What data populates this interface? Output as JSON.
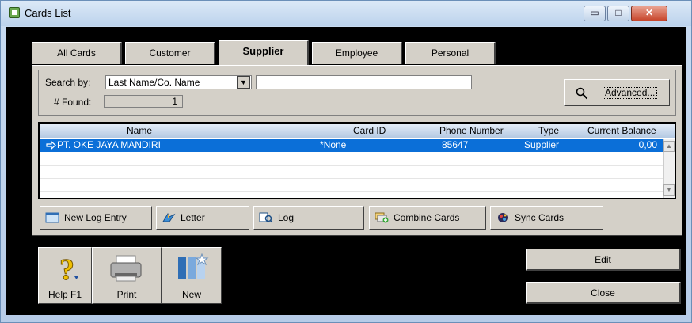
{
  "window": {
    "title": "Cards List",
    "controls": {
      "minimize": "▭",
      "maximize": "□",
      "close": "✕"
    }
  },
  "tabs": [
    {
      "label": "All Cards",
      "active": false
    },
    {
      "label": "Customer",
      "active": false
    },
    {
      "label": "Supplier",
      "active": true
    },
    {
      "label": "Employee",
      "active": false
    },
    {
      "label": "Personal",
      "active": false
    }
  ],
  "search": {
    "by_label": "Search by:",
    "by_value": "Last Name/Co. Name",
    "query": "",
    "found_label": "# Found:",
    "found_value": "1",
    "advanced_label": "Advanced..."
  },
  "table": {
    "columns": [
      "Name",
      "Card ID",
      "Phone Number",
      "Type",
      "Current Balance"
    ],
    "rows": [
      {
        "name": "PT. OKE JAYA MANDIRI",
        "card_id": "*None",
        "phone": "85647",
        "type": "Supplier",
        "balance": "0,00",
        "selected": true
      }
    ]
  },
  "actions": {
    "new_log_entry": "New Log Entry",
    "letter": "Letter",
    "log": "Log",
    "combine_cards": "Combine Cards",
    "sync_cards": "Sync Cards"
  },
  "bottom": {
    "help": "Help F1",
    "print": "Print",
    "new": "New",
    "edit": "Edit",
    "close": "Close"
  },
  "icons": {
    "app": "cards-app-icon",
    "search": "magnifier-icon",
    "row_pointer": "arrow-right-icon"
  },
  "colors": {
    "selection": "#0b6fd8",
    "face": "#d4d0c8",
    "background": "#000000"
  }
}
